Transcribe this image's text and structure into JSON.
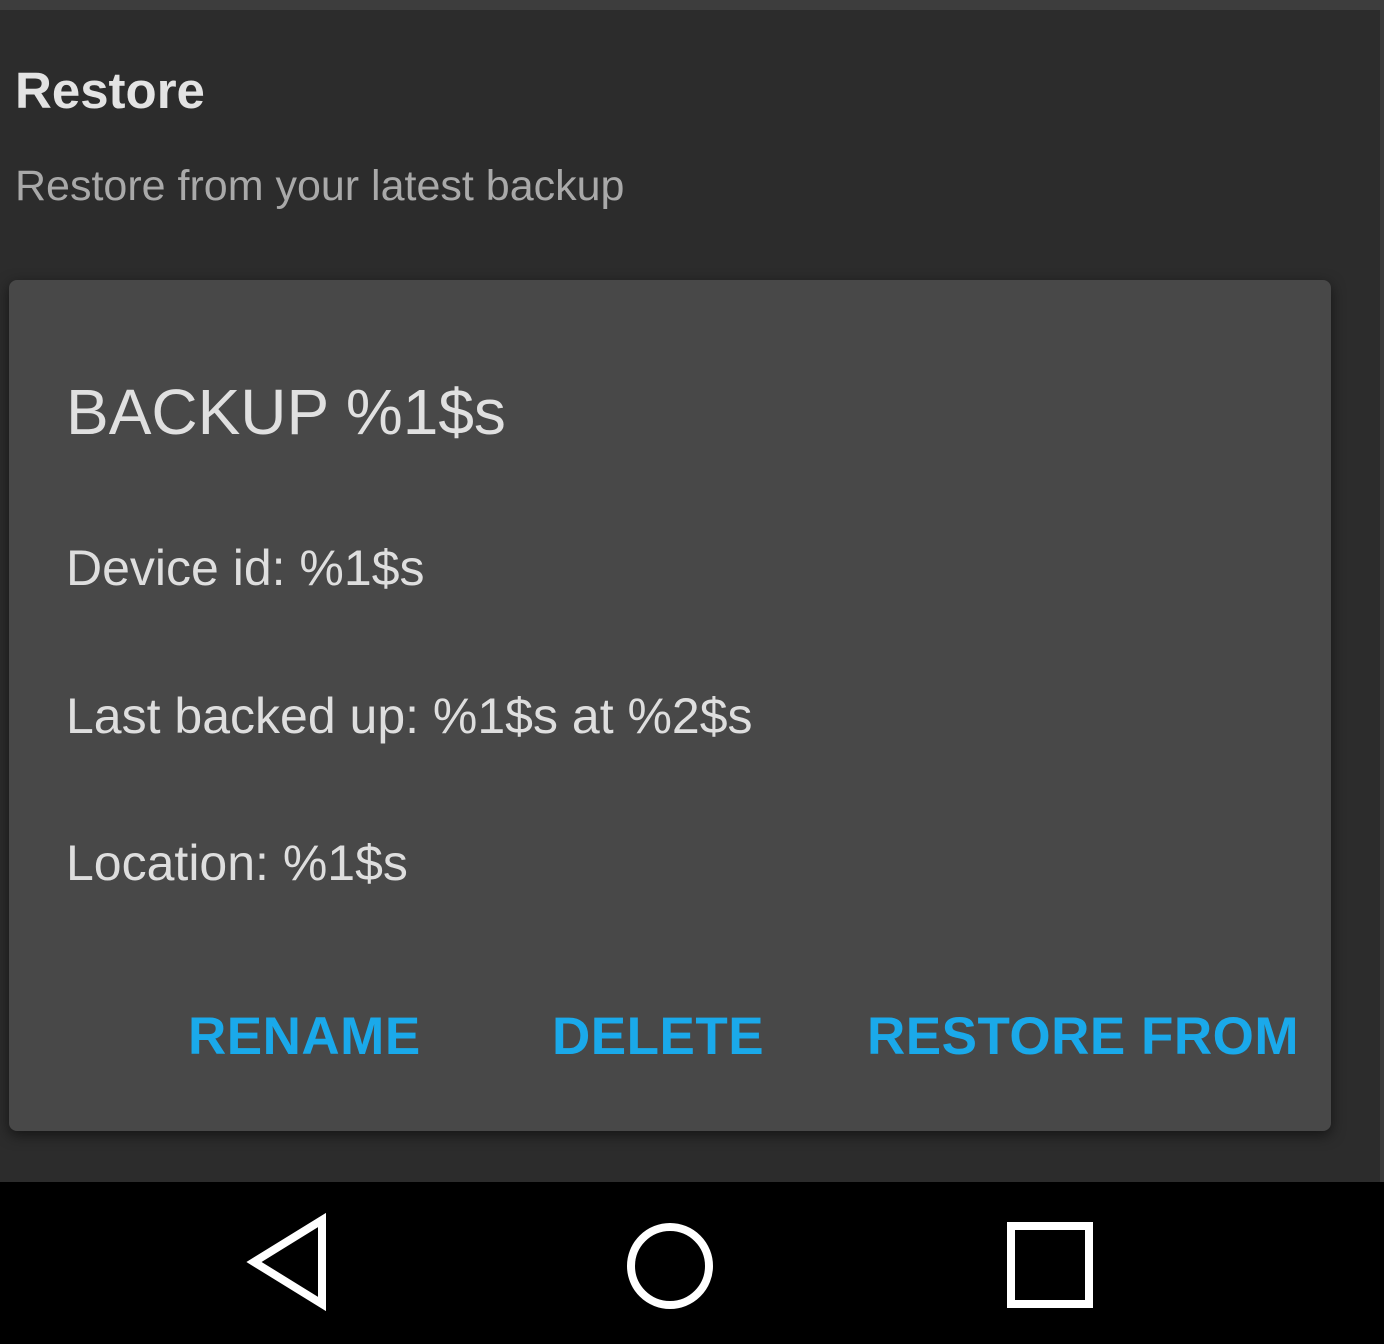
{
  "preference": {
    "title": "Restore",
    "summary": "Restore from your latest backup"
  },
  "dialog": {
    "title": "BACKUP %1$s",
    "device_id": "Device id: %1$s",
    "last_backed_up": "Last backed up: %1$s at %2$s",
    "location": "Location: %1$s",
    "buttons": {
      "rename": "RENAME",
      "delete": "DELETE",
      "restore_from": "RESTORE FROM"
    },
    "accent_color": "#1aa9ea"
  },
  "nav_bar": {
    "back_icon": "back-triangle-icon",
    "home_icon": "home-circle-icon",
    "recents_icon": "recents-square-icon"
  }
}
